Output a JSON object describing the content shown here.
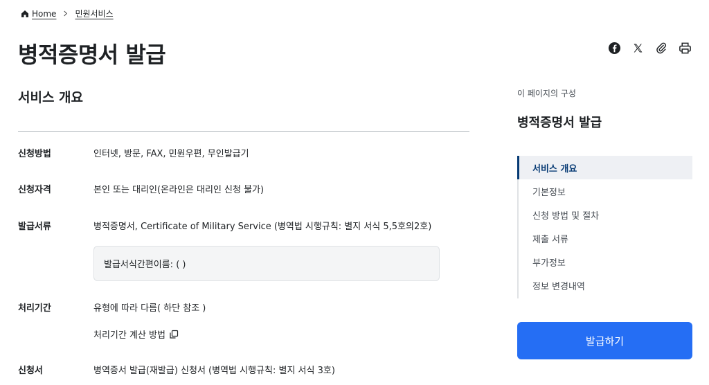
{
  "breadcrumb": {
    "home": "Home",
    "current": "민원서비스"
  },
  "page_title": "병적증명서 발급",
  "share": {
    "icons": [
      "facebook-icon",
      "x-icon",
      "paperclip-icon",
      "printer-icon"
    ]
  },
  "overview": {
    "title": "서비스 개요",
    "rows": [
      {
        "label": "신청방법",
        "value": "인터넷, 방문, FAX, 민원우편, 무인발급기"
      },
      {
        "label": "신청자격",
        "value": "본인 또는 대리인(온라인은 대리인 신청 불가)"
      },
      {
        "label": "발급서류",
        "value": "병적증명서, Certificate of Military Service (병역법 시행규칙: 별지 서식 5,5호의2호)"
      },
      {
        "label": "처리기간",
        "value": "유형에 따라 다름( 하단 참조 )"
      },
      {
        "label": "신청서",
        "value": "병역증서 발급(재발급) 신청서 (병역법 시행규칙: 별지 서식 3호)"
      }
    ],
    "box_text": "발급서식간편이름: ( )",
    "calc_link": "처리기간 계산 방법"
  },
  "toc": {
    "caption": "이 페이지의 구성",
    "title": "병적증명서 발급",
    "items": [
      "서비스 개요",
      "기본정보",
      "신청 방법 및 절차",
      "제출 서류",
      "부가정보",
      "정보 변경내역"
    ],
    "active_index": 0
  },
  "issue_button": "발급하기",
  "colors": {
    "primary": "#256ef4",
    "active_nav": "#063a74",
    "text": "#1e2124"
  }
}
